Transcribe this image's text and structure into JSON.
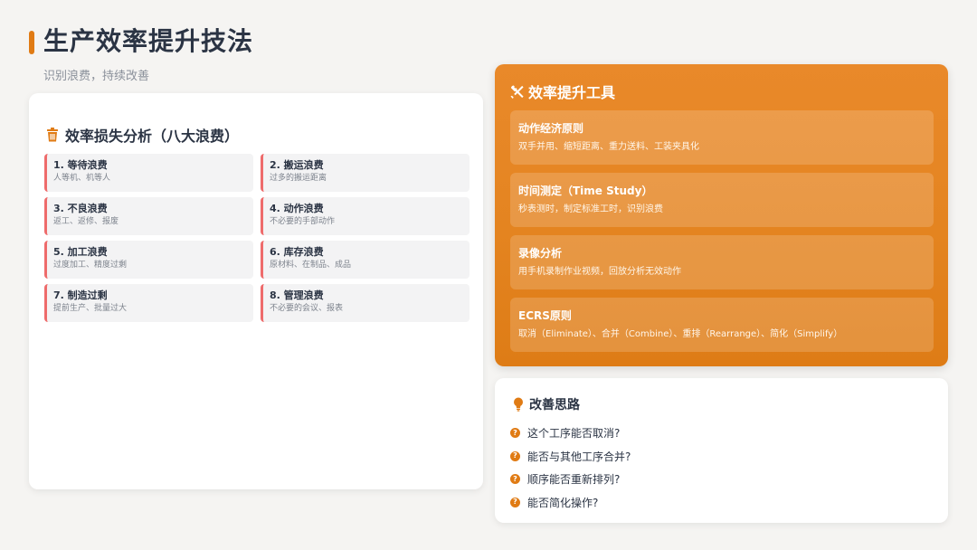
{
  "header": {
    "title": "生产效率提升技法",
    "subtitle": "识别浪费，持续改善"
  },
  "waste_section": {
    "title": "效率损失分析（八大浪费）",
    "icon": "trash-icon",
    "items": [
      {
        "title": "1. 等待浪费",
        "desc": "人等机、机等人"
      },
      {
        "title": "2. 搬运浪费",
        "desc": "过多的搬运距离"
      },
      {
        "title": "3. 不良浪费",
        "desc": "返工、返修、报废"
      },
      {
        "title": "4. 动作浪费",
        "desc": "不必要的手部动作"
      },
      {
        "title": "5. 加工浪费",
        "desc": "过度加工、精度过剩"
      },
      {
        "title": "6. 库存浪费",
        "desc": "原材料、在制品、成品"
      },
      {
        "title": "7. 制造过剩",
        "desc": "提前生产、批量过大"
      },
      {
        "title": "8. 管理浪费",
        "desc": "不必要的会议、报表"
      }
    ]
  },
  "tools_section": {
    "title": "效率提升工具",
    "icon": "tools-icon",
    "items": [
      {
        "name": "动作经济原则",
        "desc": "双手并用、缩短距离、重力送料、工装夹具化"
      },
      {
        "name": "时间测定（Time Study）",
        "desc": "秒表测时，制定标准工时，识别浪费"
      },
      {
        "name": "录像分析",
        "desc": "用手机录制作业视频，回放分析无效动作"
      },
      {
        "name": "ECRS原则",
        "desc": "取消（Eliminate）、合并（Combine）、重排（Rearrange）、简化（Simplify）"
      }
    ]
  },
  "ideas_section": {
    "title": "改善思路",
    "icon": "lightbulb-icon",
    "items": [
      "这个工序能否取消?",
      "能否与其他工序合并?",
      "顺序能否重新排列?",
      "能否简化操作?"
    ]
  },
  "colors": {
    "accent": "#e07b14",
    "waste_border": "#ee6b6b",
    "tools_bg": "#e48420"
  }
}
